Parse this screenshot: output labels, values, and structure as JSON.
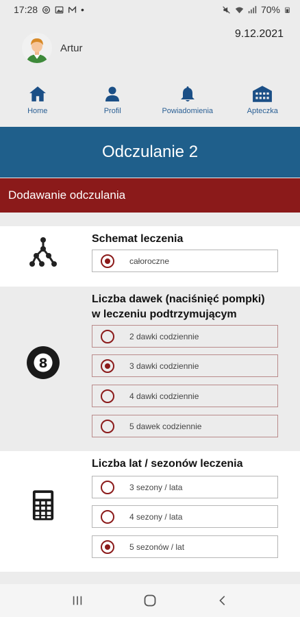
{
  "status_bar": {
    "time": "17:28",
    "battery": "70%",
    "dot": "•"
  },
  "user": {
    "name": "Artur",
    "date": "9.12.2021"
  },
  "nav": {
    "items": [
      {
        "label": "Home",
        "icon": "home-icon"
      },
      {
        "label": "Profil",
        "icon": "person-icon"
      },
      {
        "label": "Powiadomienia",
        "icon": "bell-icon"
      },
      {
        "label": "Apteczka",
        "icon": "building-icon"
      }
    ]
  },
  "title": "Odczulanie 2",
  "subtitle": "Dodawanie odczulania",
  "sections": {
    "schemat": {
      "title": "Schemat leczenia",
      "icon": "network-icon",
      "options": [
        {
          "label": "całoroczne",
          "selected": true
        }
      ]
    },
    "dawki": {
      "title_line1": "Liczba dawek (naciśnięć pompki)",
      "title_line2": "w leczeniu podtrzymującym",
      "icon": "eight-ball-icon",
      "icon_text": "8",
      "options": [
        {
          "label": "2 dawki codziennie",
          "selected": false
        },
        {
          "label": "3 dawki codziennie",
          "selected": true
        },
        {
          "label": "4 dawki codziennie",
          "selected": false
        },
        {
          "label": "5 dawek codziennie",
          "selected": false
        }
      ]
    },
    "lata": {
      "title": "Liczba lat / sezonów leczenia",
      "icon": "calculator-icon",
      "options": [
        {
          "label": "3 sezony / lata",
          "selected": false
        },
        {
          "label": "4 sezony / lata",
          "selected": false
        },
        {
          "label": "5 sezonów / lat",
          "selected": true
        }
      ]
    }
  },
  "colors": {
    "primary_blue": "#1f5f8b",
    "accent_red": "#8b1a1a",
    "nav_blue": "#1b4f86"
  }
}
